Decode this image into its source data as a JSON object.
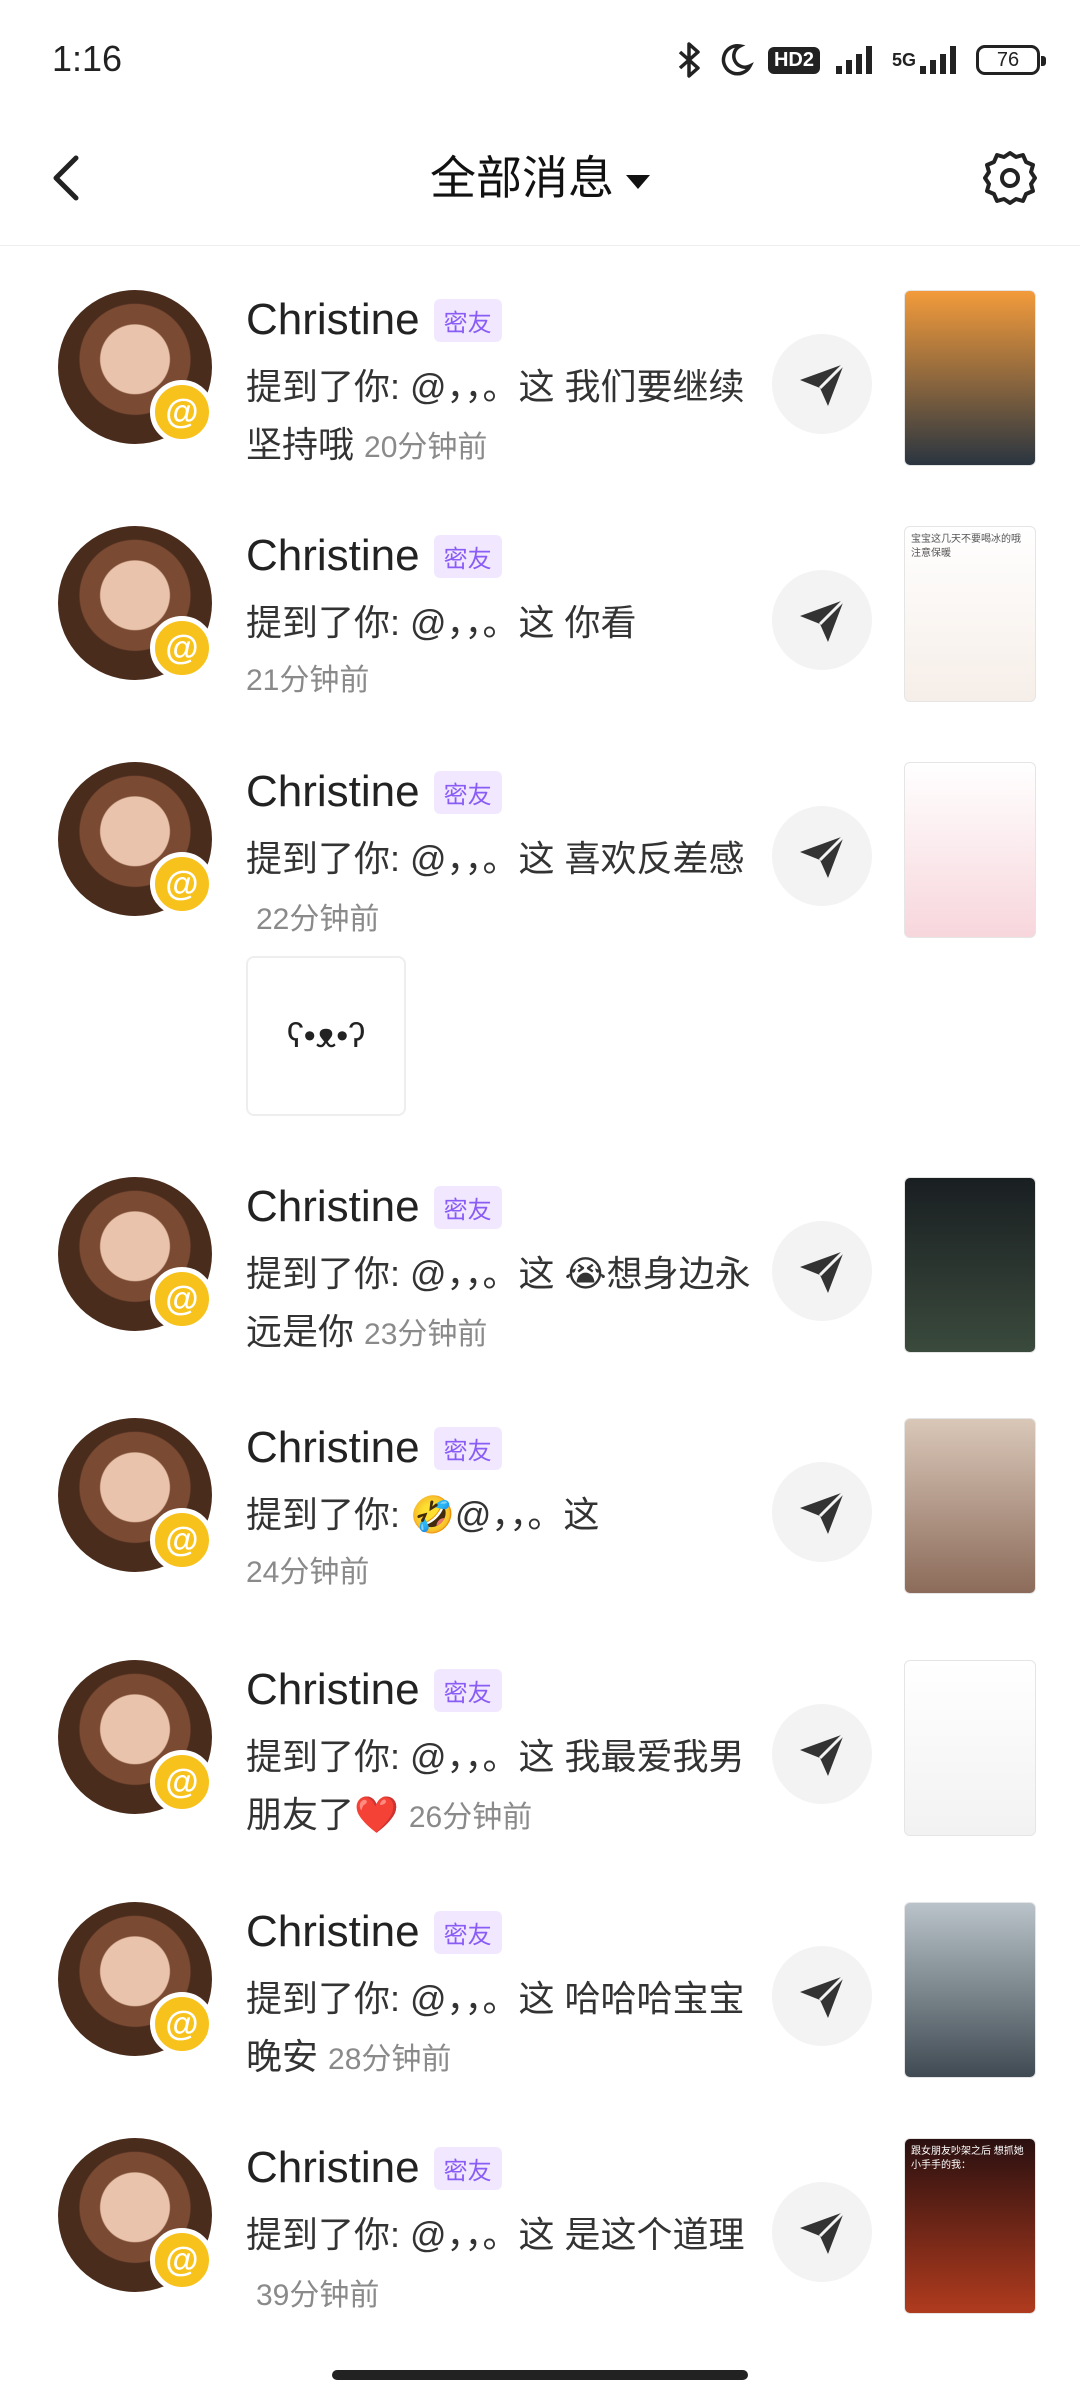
{
  "status_bar": {
    "time": "1:16",
    "hd_label": "HD2",
    "network_label": "5G",
    "battery": "76"
  },
  "header": {
    "title": "全部消息"
  },
  "items": [
    {
      "name": "Christine",
      "tag": "密友",
      "prefix": "提到了你: @，，。这 我们要继续坚持哦",
      "time": "20分钟前",
      "thumb_colors": [
        "#f39b3b",
        "#2a3540"
      ]
    },
    {
      "name": "Christine",
      "tag": "密友",
      "prefix": "提到了你: @，，。这 你看",
      "time": "21分钟前",
      "thumb_colors": [
        "#ffffff",
        "#f6eee8"
      ],
      "thumb_text": "宝宝这几天不要喝冰的哦 注意保暖"
    },
    {
      "name": "Christine",
      "tag": "密友",
      "prefix": "提到了你: @，，。这 喜欢反差感",
      "time": "22分钟前",
      "thumb_colors": [
        "#ffffff",
        "#f7d6dc"
      ],
      "sticker": "ʕ•ᴥ•ʔ"
    },
    {
      "name": "Christine",
      "tag": "密友",
      "prefix": "提到了你: @，，。这 😭想身边永远是你",
      "time": "23分钟前",
      "thumb_colors": [
        "#1a1f22",
        "#3a4a3c"
      ]
    },
    {
      "name": "Christine",
      "tag": "密友",
      "prefix": "提到了你: 🤣@，，。这",
      "time": "24分钟前",
      "thumb_colors": [
        "#d9c7b8",
        "#8c6b5a"
      ]
    },
    {
      "name": "Christine",
      "tag": "密友",
      "prefix": "提到了你: @，，。这 我最爱我男朋友了❤️",
      "time": "26分钟前",
      "thumb_colors": [
        "#ffffff",
        "#f2f2f2"
      ]
    },
    {
      "name": "Christine",
      "tag": "密友",
      "prefix": "提到了你: @，，。这 哈哈哈宝宝晚安",
      "time": "28分钟前",
      "thumb_colors": [
        "#b9c3c9",
        "#3f4a52"
      ]
    },
    {
      "name": "Christine",
      "tag": "密友",
      "prefix": "提到了你: @，，。这 是这个道理",
      "time": "39分钟前",
      "thumb_colors": [
        "#2a1010",
        "#b03b1e"
      ],
      "thumb_text": "跟女朋友吵架之后 想抓她小手手的我："
    }
  ]
}
